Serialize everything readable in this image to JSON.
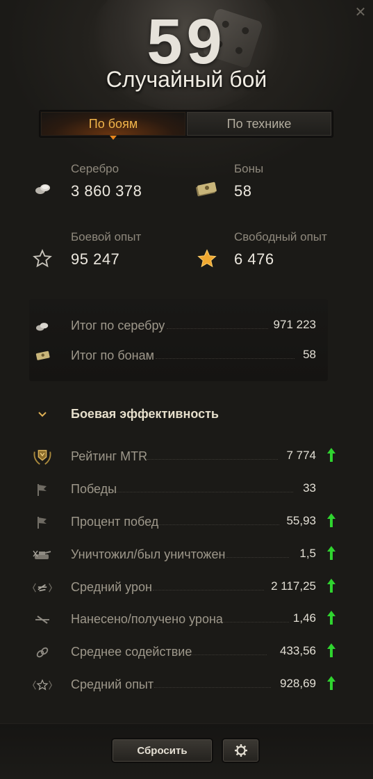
{
  "header": {
    "battle_count": "59",
    "title": "Случайный бой"
  },
  "tabs": [
    {
      "label": "По боям",
      "active": true
    },
    {
      "label": "По технике",
      "active": false
    }
  ],
  "stats": {
    "silver": {
      "label": "Серебро",
      "value": "3 860 378",
      "icon": "silver-icon"
    },
    "bonds": {
      "label": "Боны",
      "value": "58",
      "icon": "bonds-icon"
    },
    "combat_xp": {
      "label": "Боевой опыт",
      "value": "95 247",
      "icon": "star-outline-icon"
    },
    "free_xp": {
      "label": "Свободный опыт",
      "value": "6 476",
      "icon": "star-gold-icon"
    }
  },
  "summary": [
    {
      "label": "Итог по серебру",
      "value": "971 223",
      "icon": "silver-icon"
    },
    {
      "label": "Итог по бонам",
      "value": "58",
      "icon": "bonds-icon"
    }
  ],
  "efficiency": {
    "title": "Боевая эффективность",
    "rows": [
      {
        "label": "Рейтинг MTR",
        "value": "7 774",
        "icon": "mtr-rating-icon",
        "trend": "up"
      },
      {
        "label": "Победы",
        "value": "33",
        "icon": "flag-icon",
        "trend": ""
      },
      {
        "label": "Процент побед",
        "value": "55,93",
        "icon": "flag-icon",
        "trend": "up"
      },
      {
        "label": "Уничтожил/был уничтожен",
        "value": "1,5",
        "icon": "destroyed-tank-icon",
        "trend": "up"
      },
      {
        "label": "Средний урон",
        "value": "2 117,25",
        "icon": "damage-icon",
        "trend": "up"
      },
      {
        "label": "Нанесено/получено урона",
        "value": "1,46",
        "icon": "damage-ratio-icon",
        "trend": "up"
      },
      {
        "label": "Среднее содействие",
        "value": "433,56",
        "icon": "assist-icon",
        "trend": "up"
      },
      {
        "label": "Средний опыт",
        "value": "928,69",
        "icon": "xp-icon",
        "trend": "up"
      }
    ]
  },
  "buttons": {
    "reset": "Сбросить",
    "settings_icon": "gear-icon"
  },
  "colors": {
    "accent": "#f2b54a",
    "trend_up": "#2fd42f",
    "gold_star": "#f0a830"
  }
}
